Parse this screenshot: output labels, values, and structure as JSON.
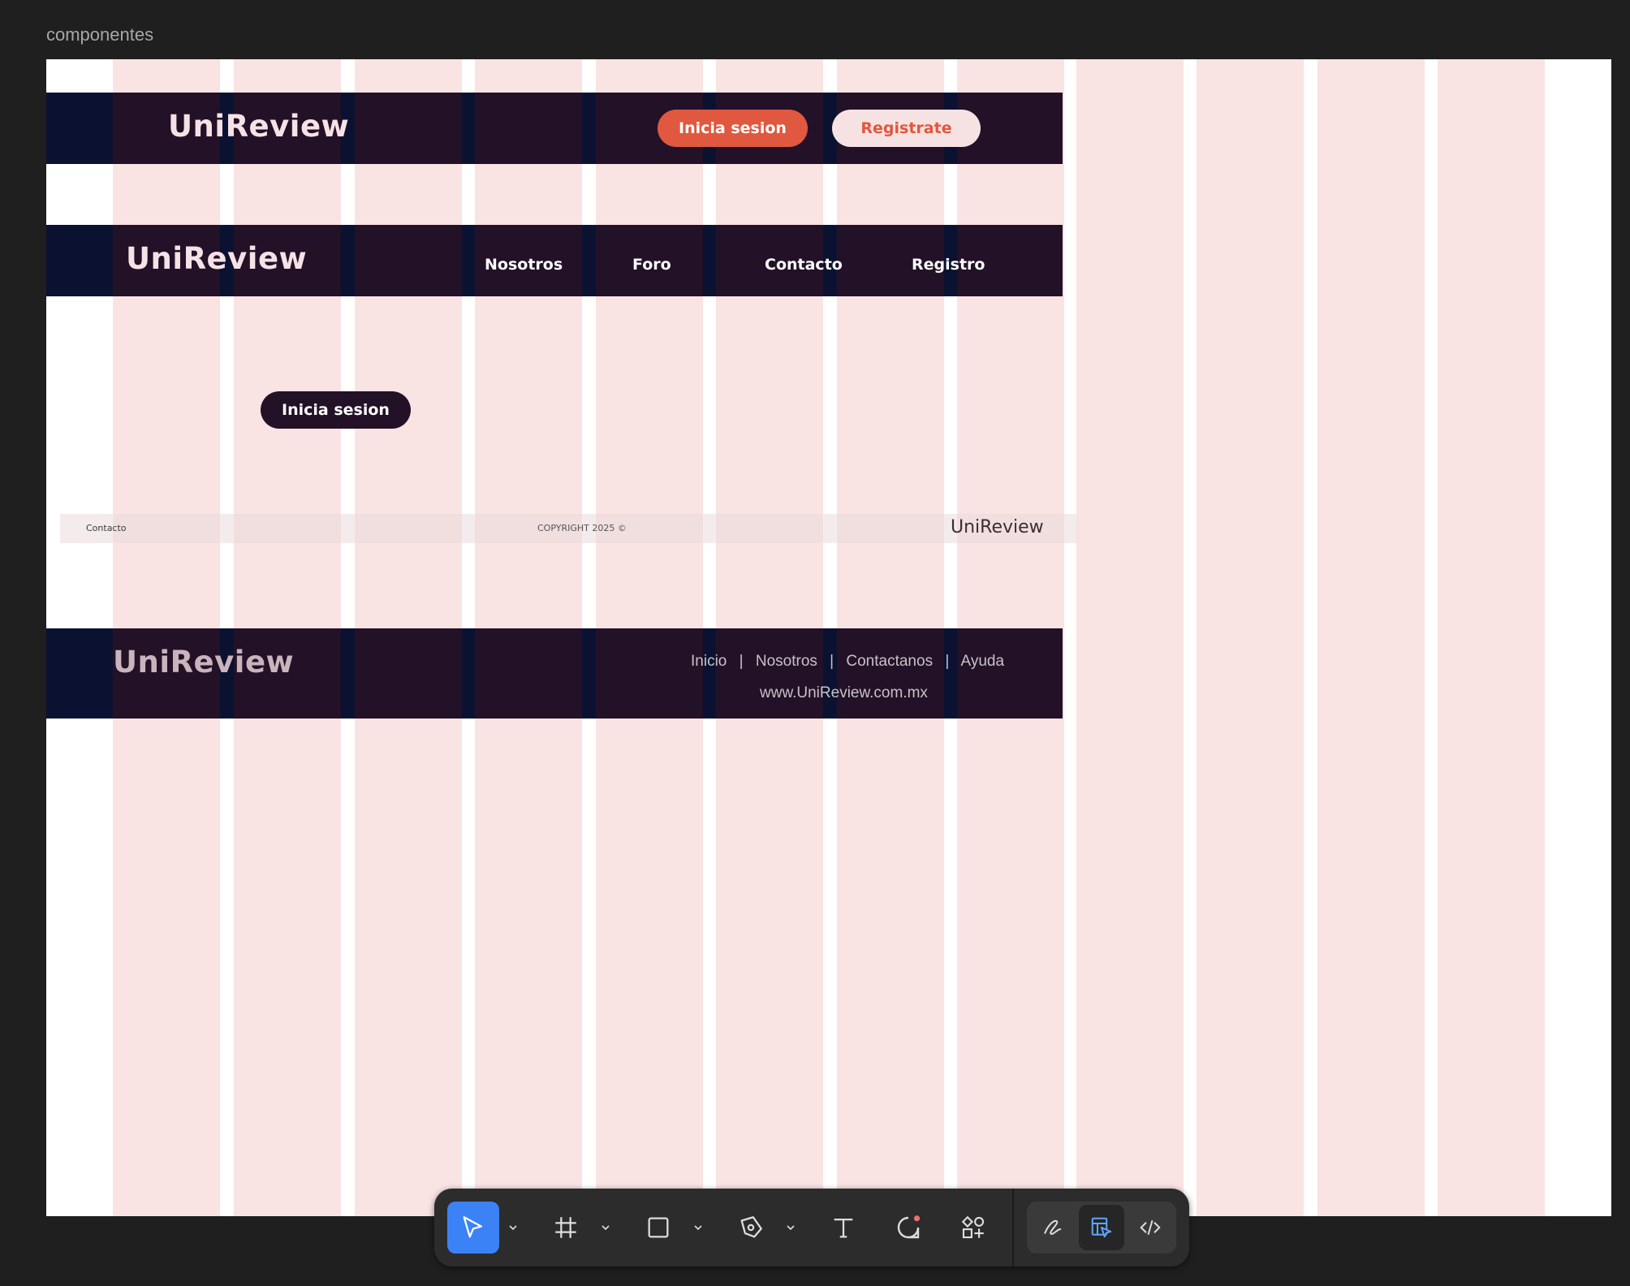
{
  "canvas": {
    "frame_label": "componentes"
  },
  "header_auth": {
    "logo": "UniReview",
    "login_label": "Inicia sesion",
    "register_label": "Registrate"
  },
  "header_nav": {
    "logo": "UniReview",
    "links": [
      "Nosotros",
      "Foro",
      "Contacto",
      "Registro"
    ]
  },
  "standalone_button": {
    "label": "Inicia sesion"
  },
  "footer_light": {
    "contact": "Contacto",
    "copyright": "COPYRIGHT 2025 ©",
    "logo": "UniReview"
  },
  "footer_dark": {
    "logo": "UniReview",
    "links": [
      "Inicio",
      "Nosotros",
      "Contactanos",
      "Ayuda"
    ],
    "separator": "|",
    "url": "www.UniReview.com.mx"
  },
  "toolbar": {
    "tools": [
      "move-tool",
      "frame-tool",
      "rectangle-tool",
      "pen-tool",
      "text-tool",
      "comment-tool",
      "actions-tool"
    ],
    "modes": [
      "draw-mode",
      "design-mode",
      "dev-mode"
    ],
    "active_tool": "move-tool",
    "active_mode": "design-mode",
    "accent": "#3b82f6"
  },
  "colors": {
    "dark_bar": "#221127",
    "grid_column": "#f9e3e3",
    "accent_orange": "#e0583f",
    "light_pill": "#f6e2e2"
  }
}
